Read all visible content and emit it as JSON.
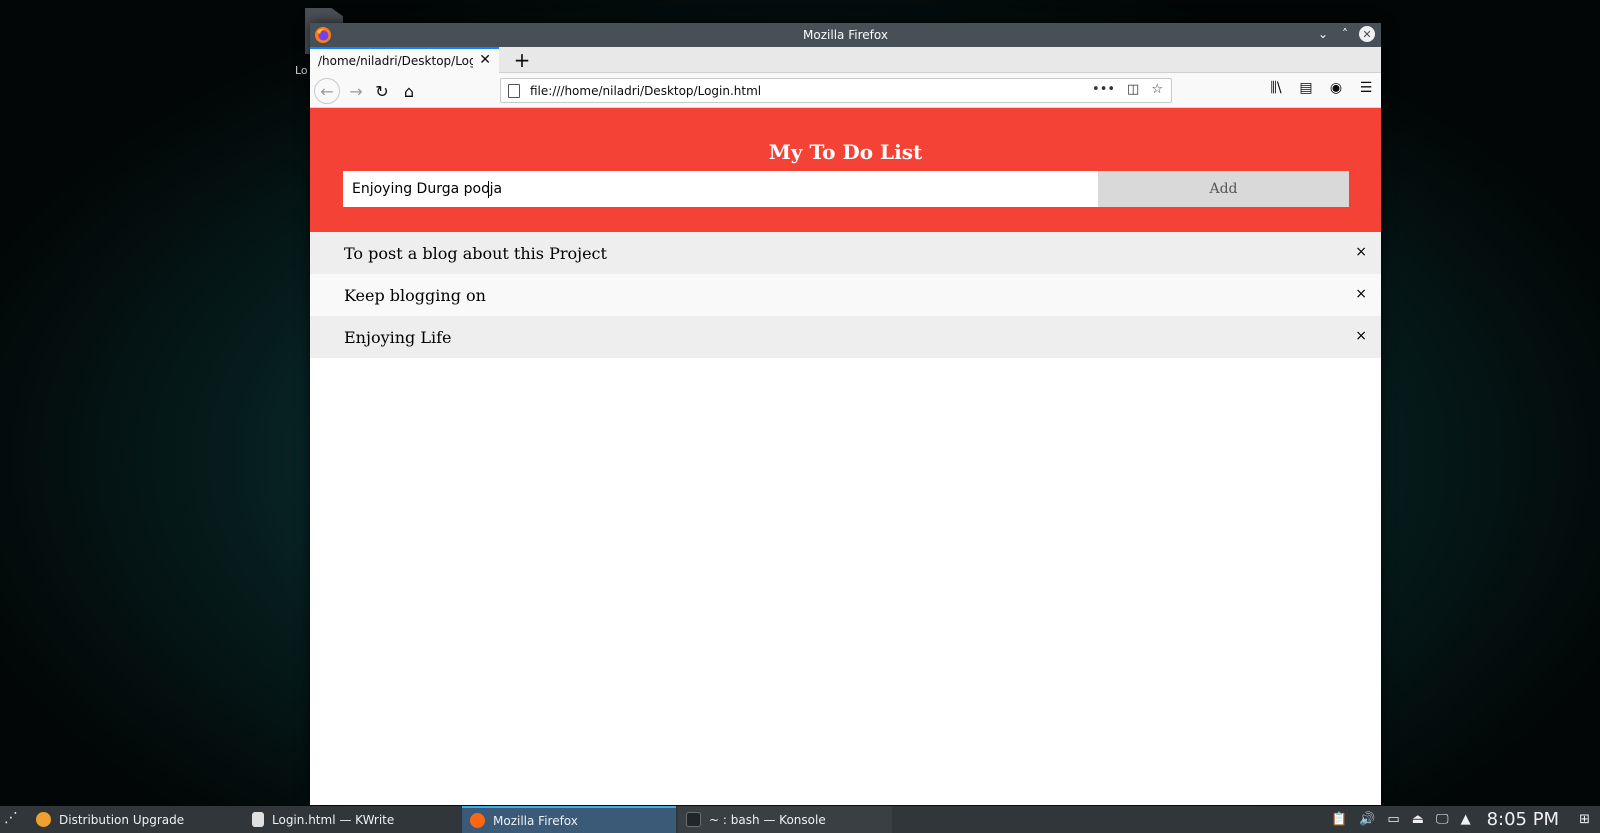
{
  "desktop": {
    "icon_label": "Lo"
  },
  "window": {
    "title": "Mozilla Firefox",
    "controls": {
      "minimize": "⌄",
      "maximize": "˄",
      "close": "✕"
    }
  },
  "browser": {
    "tab": {
      "title": "/home/niladri/Desktop/Login",
      "close": "✕"
    },
    "new_tab": "+",
    "nav": {
      "back": "←",
      "forward": "→",
      "reload": "↻",
      "home": "⌂"
    },
    "url": "file:///home/niladri/Desktop/Login.html",
    "url_actions": {
      "more": "•••",
      "pocket": "◫",
      "bookmark": "☆"
    },
    "toolbar": {
      "library": "⫼\\",
      "sidebar": "▤",
      "account": "◉",
      "menu": "☰"
    }
  },
  "app": {
    "title": "My To Do List",
    "input_value": "Enjoying Durga pooja",
    "add_label": "Add",
    "items": [
      {
        "text": "To post a blog about this Project",
        "close": "×"
      },
      {
        "text": "Keep blogging on",
        "close": "×"
      },
      {
        "text": "Enjoying Life",
        "close": "×"
      }
    ]
  },
  "taskbar": {
    "launcher": "⋰",
    "tasks": [
      {
        "label": "Distribution Upgrade",
        "icon": "upgrade-icon",
        "color": "#f0a030"
      },
      {
        "label": "Login.html — KWrite",
        "icon": "document-icon",
        "color": "#e0e0e0"
      },
      {
        "label": "Mozilla Firefox",
        "icon": "firefox-icon",
        "color": "#ff6611"
      },
      {
        "label": "~ : bash — Konsole",
        "icon": "terminal-icon",
        "color": "#232629"
      }
    ],
    "tray": {
      "clipboard": "📋",
      "volume": "🔊",
      "battery": "▭",
      "usb": "⏏",
      "display": "🖵",
      "expand": "▲"
    },
    "clock": "8:05 PM",
    "show_desktop": "⊞"
  },
  "colors": {
    "accent": "#f44336",
    "tab_indicator": "#0a84ff",
    "taskbar_active": "#3daee9"
  }
}
